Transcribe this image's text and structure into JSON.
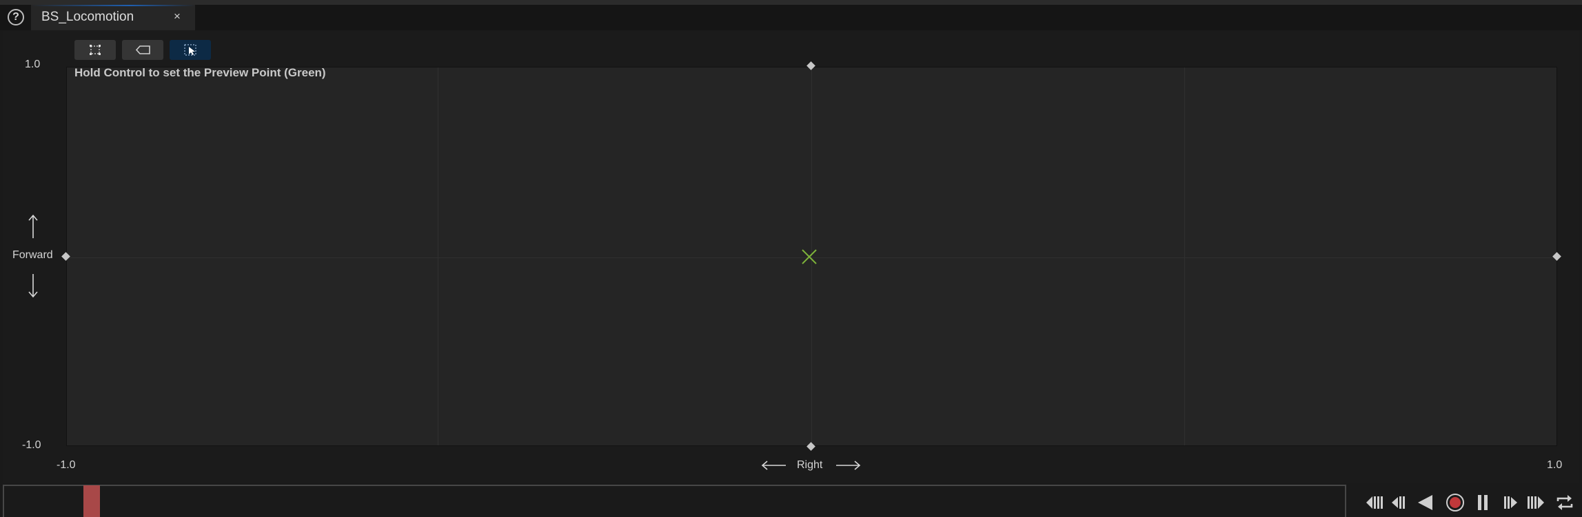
{
  "tab": {
    "title": "BS_Locomotion",
    "close": "×",
    "help": "?"
  },
  "toolbar": {
    "buttons": [
      {
        "icon": "fit-to-grid-icon",
        "active": false
      },
      {
        "icon": "tag-icon",
        "active": false
      },
      {
        "icon": "select-cursor-icon",
        "active": true
      }
    ]
  },
  "graph": {
    "hint": "Hold Control to set the Preview Point (Green)",
    "y_axis": {
      "label": "Forward",
      "max": "1.0",
      "min": "-1.0"
    },
    "x_axis": {
      "label": "Right",
      "min": "-1.0",
      "max": "1.0"
    },
    "preview_point": {
      "x": 0.0,
      "y": 0.0,
      "color": "#7db33a"
    }
  },
  "timeline": {
    "scrub_color": "#a84848"
  },
  "playback": {
    "buttons": [
      "jump-to-start-icon",
      "step-back-icon",
      "play-reverse-icon",
      "record-icon",
      "pause-icon",
      "step-forward-icon",
      "jump-to-end-icon",
      "loop-icon"
    ]
  }
}
